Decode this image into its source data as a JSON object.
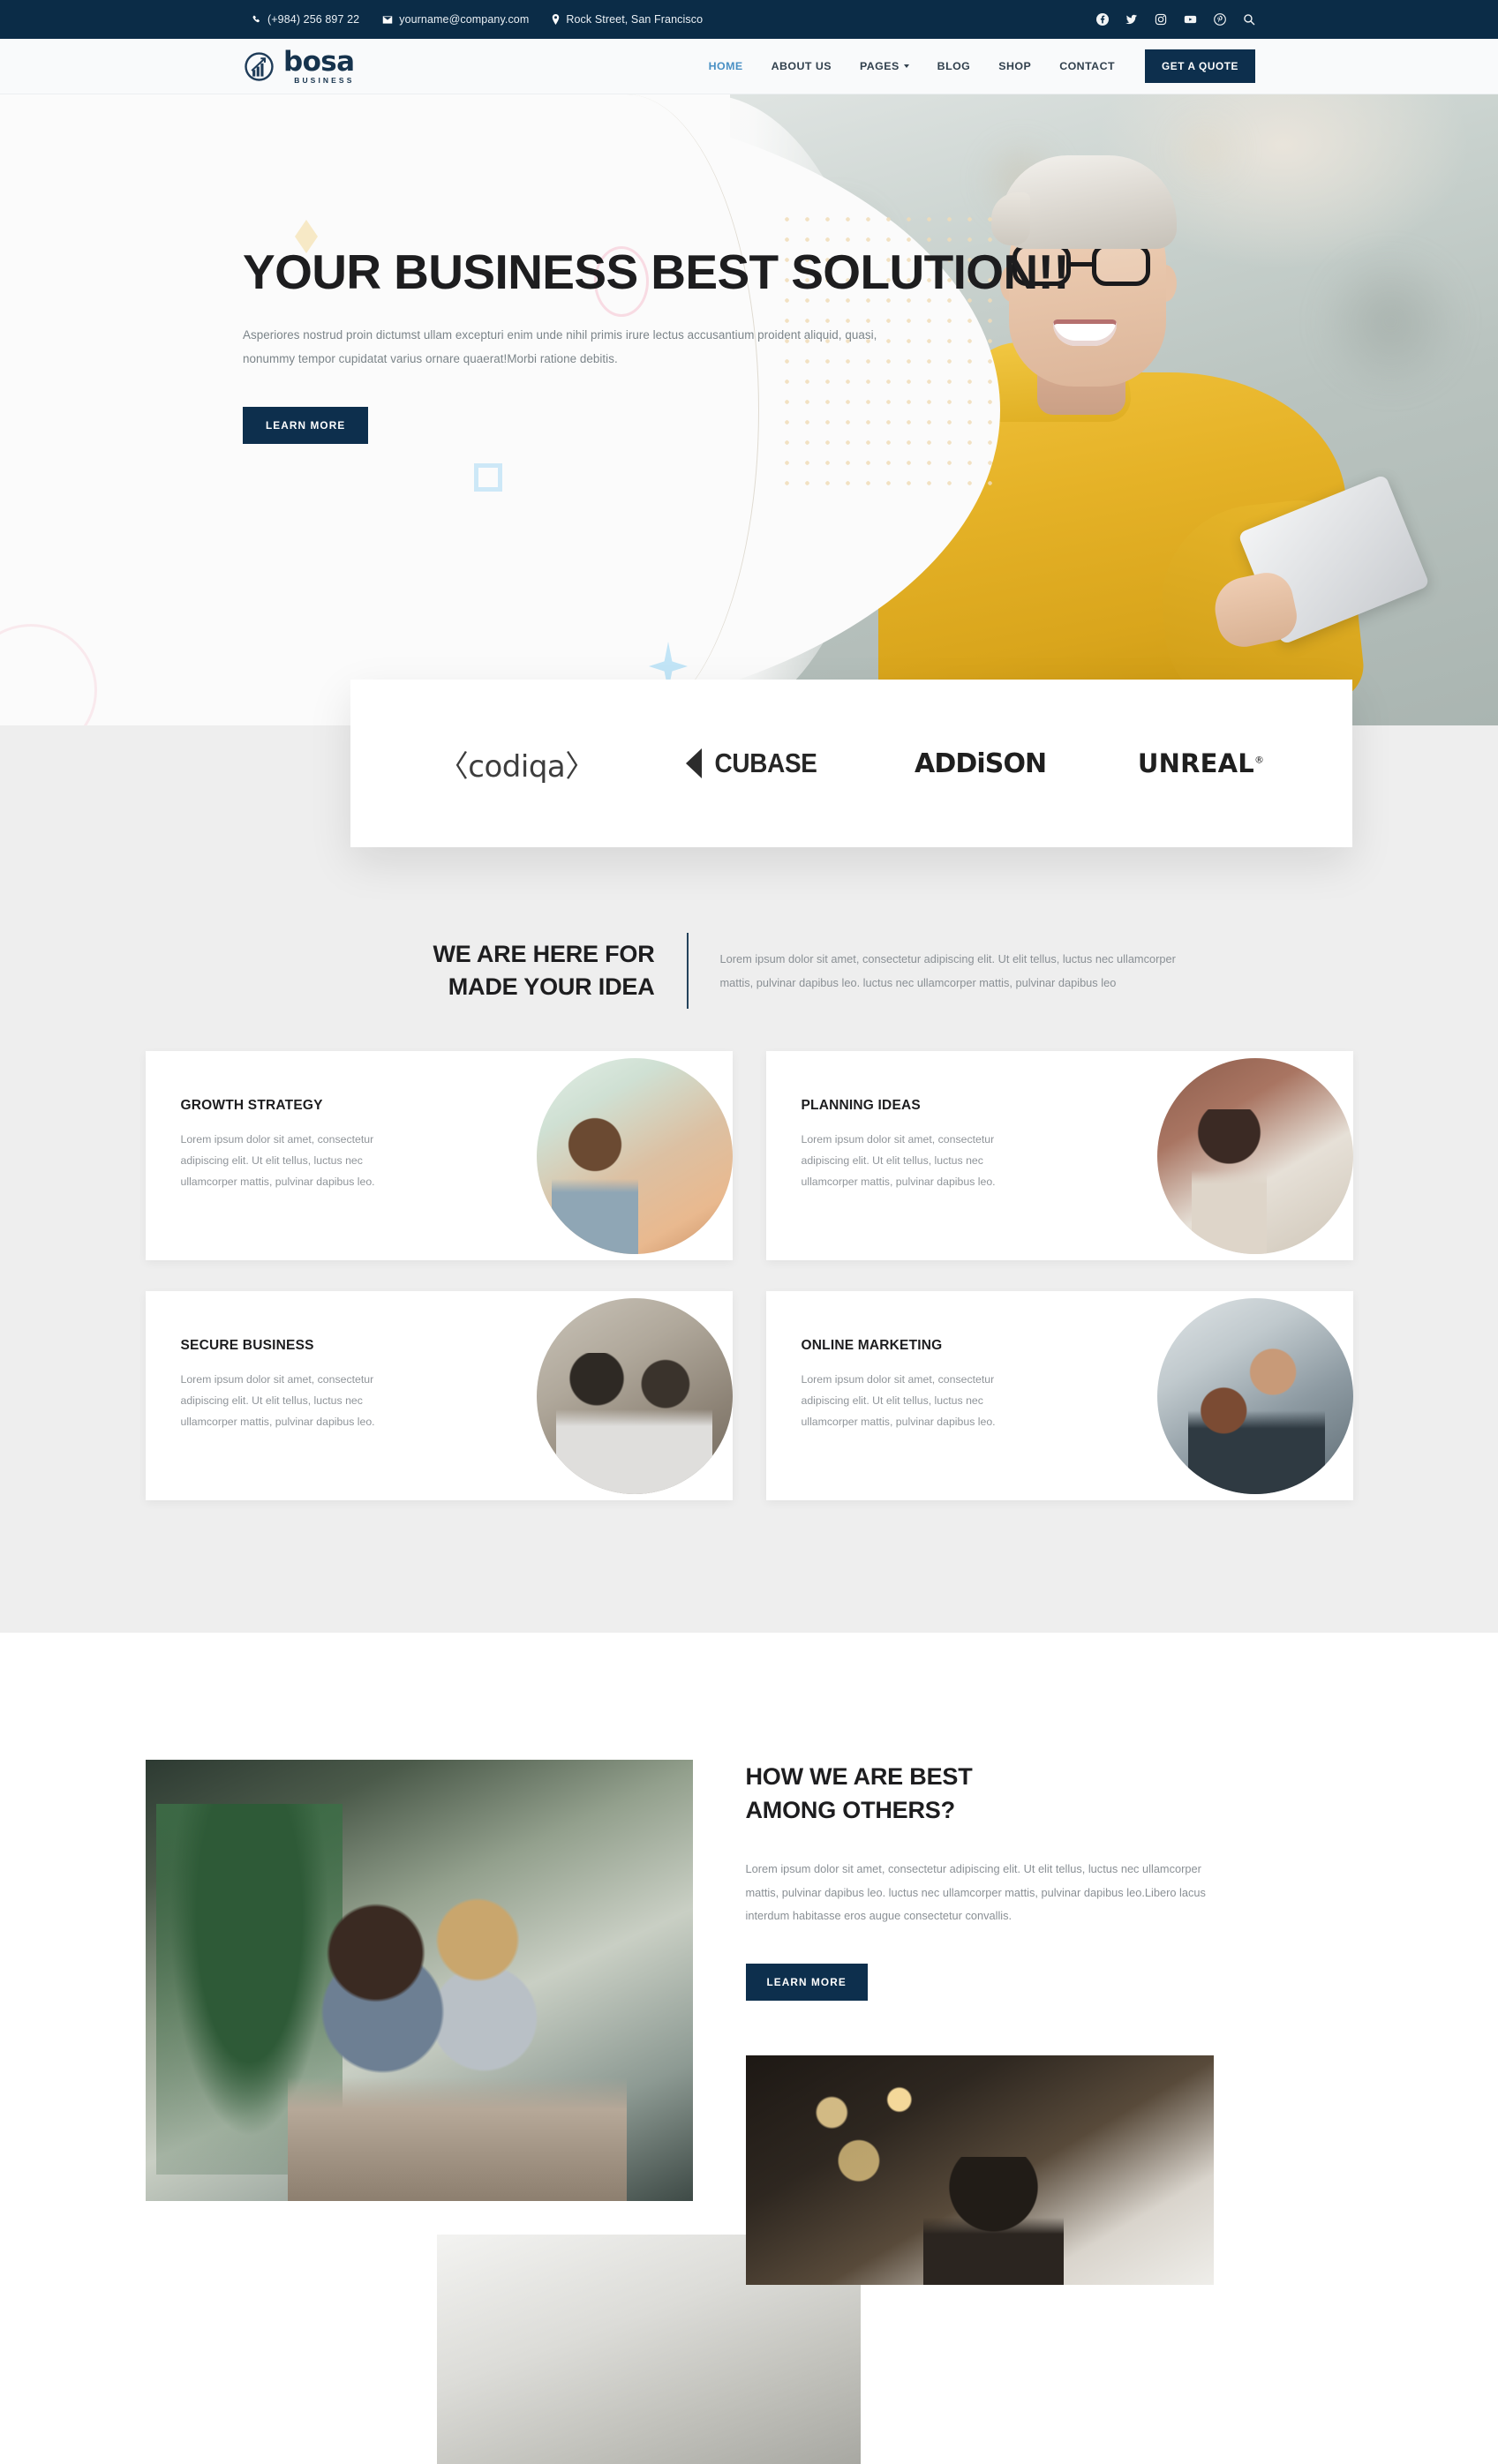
{
  "topbar": {
    "phone": "(+984) 256 897 22",
    "email": "yourname@company.com",
    "address": "Rock Street, San Francisco",
    "social": [
      {
        "name": "facebook-icon",
        "label": "Facebook"
      },
      {
        "name": "twitter-icon",
        "label": "Twitter"
      },
      {
        "name": "instagram-icon",
        "label": "Instagram"
      },
      {
        "name": "youtube-icon",
        "label": "YouTube"
      },
      {
        "name": "pinterest-icon",
        "label": "Pinterest"
      },
      {
        "name": "search-icon",
        "label": "Search"
      }
    ],
    "bg_color": "#0b2c47"
  },
  "header": {
    "brand_name": "bosa",
    "brand_sub": "BUSINESS",
    "brand_color": "#16334d",
    "nav": [
      {
        "label": "HOME",
        "active": true,
        "has_caret": false
      },
      {
        "label": "ABOUT US",
        "active": false,
        "has_caret": false
      },
      {
        "label": "PAGES",
        "active": false,
        "has_caret": true
      },
      {
        "label": "BLOG",
        "active": false,
        "has_caret": false
      },
      {
        "label": "SHOP",
        "active": false,
        "has_caret": false
      },
      {
        "label": "CONTACT",
        "active": false,
        "has_caret": false
      }
    ],
    "quote_button": "GET A QUOTE",
    "active_color": "#4a90c4",
    "button_color": "#0d2f4d"
  },
  "hero": {
    "title": "YOUR BUSINESS BEST SOLUTION!!",
    "subtitle": "Asperiores nostrud proin dictumst ullam excepturi enim unde nihil primis irure lectus accusantium proident aliquid, quasi, nonummy tempor cupidatat varius ornare quaerat!Morbi ratione debitis.",
    "button": "LEARN MORE"
  },
  "clients": {
    "logos": [
      {
        "name": "codiqa-logo",
        "text": "〈codiqa〉"
      },
      {
        "name": "cubase-logo",
        "text": "CUBASE"
      },
      {
        "name": "addison-logo",
        "text": "ADDiSON"
      },
      {
        "name": "unreal-logo",
        "text": "UNREAL"
      }
    ]
  },
  "services": {
    "heading_line1": "WE ARE HERE FOR",
    "heading_line2": "MADE YOUR IDEA",
    "description": "Lorem ipsum dolor sit amet, consectetur adipiscing elit. Ut elit tellus, luctus nec ullamcorper mattis, pulvinar dapibus leo. luctus nec ullamcorper mattis, pulvinar dapibus leo",
    "cards": [
      {
        "title": "GROWTH STRATEGY",
        "text": "Lorem ipsum dolor sit amet, consectetur adipiscing elit. Ut elit tellus, luctus nec ullamcorper mattis, pulvinar dapibus leo.",
        "image": "couple-laughing-photo"
      },
      {
        "title": "PLANNING IDEAS",
        "text": "Lorem ipsum dolor sit amet, consectetur adipiscing elit. Ut elit tellus, luctus nec ullamcorper mattis, pulvinar dapibus leo.",
        "image": "team-meeting-photo"
      },
      {
        "title": "SECURE BUSINESS",
        "text": "Lorem ipsum dolor sit amet, consectetur adipiscing elit. Ut elit tellus, luctus nec ullamcorper mattis, pulvinar dapibus leo.",
        "image": "group-handshake-photo"
      },
      {
        "title": "ONLINE MARKETING",
        "text": "Lorem ipsum dolor sit amet, consectetur adipiscing elit. Ut elit tellus, luctus nec ullamcorper mattis, pulvinar dapibus leo.",
        "image": "office-discussion-photo"
      }
    ],
    "bg_color": "#eeeeee"
  },
  "best": {
    "title_line1": "HOW WE ARE BEST",
    "title_line2": "AMONG OTHERS?",
    "text": "Lorem ipsum dolor sit amet, consectetur adipiscing elit. Ut elit tellus, luctus nec ullamcorper mattis, pulvinar dapibus leo. luctus nec ullamcorper mattis, pulvinar dapibus leo.Libero lacus interdum habitasse eros augue consectetur convallis.",
    "button": "LEARN MORE",
    "image_main": "couple-at-laptop-photo",
    "image_secondary": "office-interior-photo",
    "image_right": "man-in-restaurant-photo"
  }
}
